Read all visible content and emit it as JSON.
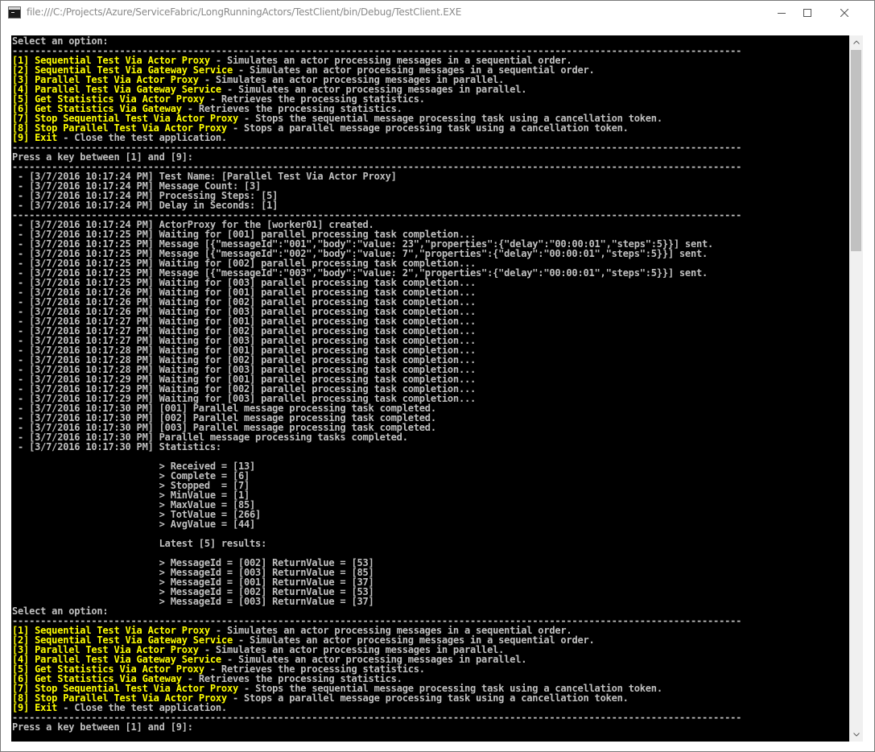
{
  "window": {
    "title": "file:///C:/Projects/Azure/ServiceFabric/LongRunningActors/TestClient/bin/Debug/TestClient.EXE"
  },
  "console": {
    "blocks": [
      {
        "type": "text",
        "text": "Select an option:"
      },
      {
        "type": "rule"
      },
      {
        "type": "menu"
      },
      {
        "type": "rule"
      },
      {
        "type": "text",
        "text": "Press a key between [1] and [9]:"
      },
      {
        "type": "rule"
      },
      {
        "type": "text",
        "text": " - [3/7/2016 10:17:24 PM] Test Name: [Parallel Test Via Actor Proxy]"
      },
      {
        "type": "text",
        "text": " - [3/7/2016 10:17:24 PM] Message Count: [3]"
      },
      {
        "type": "text",
        "text": " - [3/7/2016 10:17:24 PM] Processing Steps: [5]"
      },
      {
        "type": "text",
        "text": " - [3/7/2016 10:17:24 PM] Delay in Seconds: [1]"
      },
      {
        "type": "rule"
      },
      {
        "type": "text",
        "text": " - [3/7/2016 10:17:24 PM] ActorProxy for the [worker01] created."
      },
      {
        "type": "text",
        "text": " - [3/7/2016 10:17:25 PM] Waiting for [001] parallel processing task completion..."
      },
      {
        "type": "text",
        "text": " - [3/7/2016 10:17:25 PM] Message [{\"messageId\":\"001\",\"body\":\"value: 23\",\"properties\":{\"delay\":\"00:00:01\",\"steps\":5}}] sent."
      },
      {
        "type": "text",
        "text": " - [3/7/2016 10:17:25 PM] Message [{\"messageId\":\"002\",\"body\":\"value: 7\",\"properties\":{\"delay\":\"00:00:01\",\"steps\":5}}] sent."
      },
      {
        "type": "text",
        "text": " - [3/7/2016 10:17:25 PM] Waiting for [002] parallel processing task completion..."
      },
      {
        "type": "text",
        "text": " - [3/7/2016 10:17:25 PM] Message [{\"messageId\":\"003\",\"body\":\"value: 2\",\"properties\":{\"delay\":\"00:00:01\",\"steps\":5}}] sent."
      },
      {
        "type": "text",
        "text": " - [3/7/2016 10:17:25 PM] Waiting for [003] parallel processing task completion..."
      },
      {
        "type": "text",
        "text": " - [3/7/2016 10:17:26 PM] Waiting for [001] parallel processing task completion..."
      },
      {
        "type": "text",
        "text": " - [3/7/2016 10:17:26 PM] Waiting for [002] parallel processing task completion..."
      },
      {
        "type": "text",
        "text": " - [3/7/2016 10:17:26 PM] Waiting for [003] parallel processing task completion..."
      },
      {
        "type": "text",
        "text": " - [3/7/2016 10:17:27 PM] Waiting for [001] parallel processing task completion..."
      },
      {
        "type": "text",
        "text": " - [3/7/2016 10:17:27 PM] Waiting for [002] parallel processing task completion..."
      },
      {
        "type": "text",
        "text": " - [3/7/2016 10:17:27 PM] Waiting for [003] parallel processing task completion..."
      },
      {
        "type": "text",
        "text": " - [3/7/2016 10:17:28 PM] Waiting for [001] parallel processing task completion..."
      },
      {
        "type": "text",
        "text": " - [3/7/2016 10:17:28 PM] Waiting for [002] parallel processing task completion..."
      },
      {
        "type": "text",
        "text": " - [3/7/2016 10:17:28 PM] Waiting for [003] parallel processing task completion..."
      },
      {
        "type": "text",
        "text": " - [3/7/2016 10:17:29 PM] Waiting for [001] parallel processing task completion..."
      },
      {
        "type": "text",
        "text": " - [3/7/2016 10:17:29 PM] Waiting for [002] parallel processing task completion..."
      },
      {
        "type": "text",
        "text": " - [3/7/2016 10:17:29 PM] Waiting for [003] parallel processing task completion..."
      },
      {
        "type": "text",
        "text": " - [3/7/2016 10:17:30 PM] [001] Parallel message processing task completed."
      },
      {
        "type": "text",
        "text": " - [3/7/2016 10:17:30 PM] [002] Parallel message processing task completed."
      },
      {
        "type": "text",
        "text": " - [3/7/2016 10:17:30 PM] [003] Parallel message processing task completed."
      },
      {
        "type": "text",
        "text": " - [3/7/2016 10:17:30 PM] Parallel message processing tasks completed."
      },
      {
        "type": "text",
        "text": " - [3/7/2016 10:17:30 PM] Statistics:"
      },
      {
        "type": "text",
        "text": ""
      },
      {
        "type": "text",
        "text": "                          > Received = [13]"
      },
      {
        "type": "text",
        "text": "                          > Complete = [6]"
      },
      {
        "type": "text",
        "text": "                          > Stopped  = [7]"
      },
      {
        "type": "text",
        "text": "                          > MinValue = [1]"
      },
      {
        "type": "text",
        "text": "                          > MaxValue = [85]"
      },
      {
        "type": "text",
        "text": "                          > TotValue = [266]"
      },
      {
        "type": "text",
        "text": "                          > AvgValue = [44]"
      },
      {
        "type": "text",
        "text": ""
      },
      {
        "type": "text",
        "text": "                          Latest [5] results:"
      },
      {
        "type": "text",
        "text": ""
      },
      {
        "type": "text",
        "text": "                          > MessageId = [002] ReturnValue = [53]"
      },
      {
        "type": "text",
        "text": "                          > MessageId = [003] ReturnValue = [85]"
      },
      {
        "type": "text",
        "text": "                          > MessageId = [001] ReturnValue = [37]"
      },
      {
        "type": "text",
        "text": "                          > MessageId = [002] ReturnValue = [53]"
      },
      {
        "type": "text",
        "text": "                          > MessageId = [003] ReturnValue = [37]"
      },
      {
        "type": "text",
        "text": "Select an option:"
      },
      {
        "type": "rule"
      },
      {
        "type": "menu"
      },
      {
        "type": "rule"
      },
      {
        "type": "text",
        "text": "Press a key between [1] and [9]:"
      }
    ],
    "menu": [
      {
        "key": "[1]",
        "title": "Sequential Test Via Actor Proxy",
        "desc": " - Simulates an actor processing messages in a sequential order."
      },
      {
        "key": "[2]",
        "title": "Sequential Test Via Gateway Service",
        "desc": " - Simulates an actor processing messages in a sequential order."
      },
      {
        "key": "[3]",
        "title": "Parallel Test Via Actor Proxy",
        "desc": " - Simulates an actor processing messages in parallel."
      },
      {
        "key": "[4]",
        "title": "Parallel Test Via Gateway Service",
        "desc": " - Simulates an actor processing messages in parallel."
      },
      {
        "key": "[5]",
        "title": "Get Statistics Via Actor Proxy",
        "desc": " - Retrieves the processing statistics."
      },
      {
        "key": "[6]",
        "title": "Get Statistics Via Gateway",
        "desc": " - Retrieves the processing statistics."
      },
      {
        "key": "[7]",
        "title": "Stop Sequential Test Via Actor Proxy",
        "desc": " - Stops the sequential message processing task using a cancellation token."
      },
      {
        "key": "[8]",
        "title": "Stop Parallel Test Via Actor Proxy",
        "desc": " - Stops a parallel message processing task using a cancellation token."
      },
      {
        "key": "[9]",
        "title": "Exit",
        "desc": " - Close the test application."
      }
    ]
  }
}
